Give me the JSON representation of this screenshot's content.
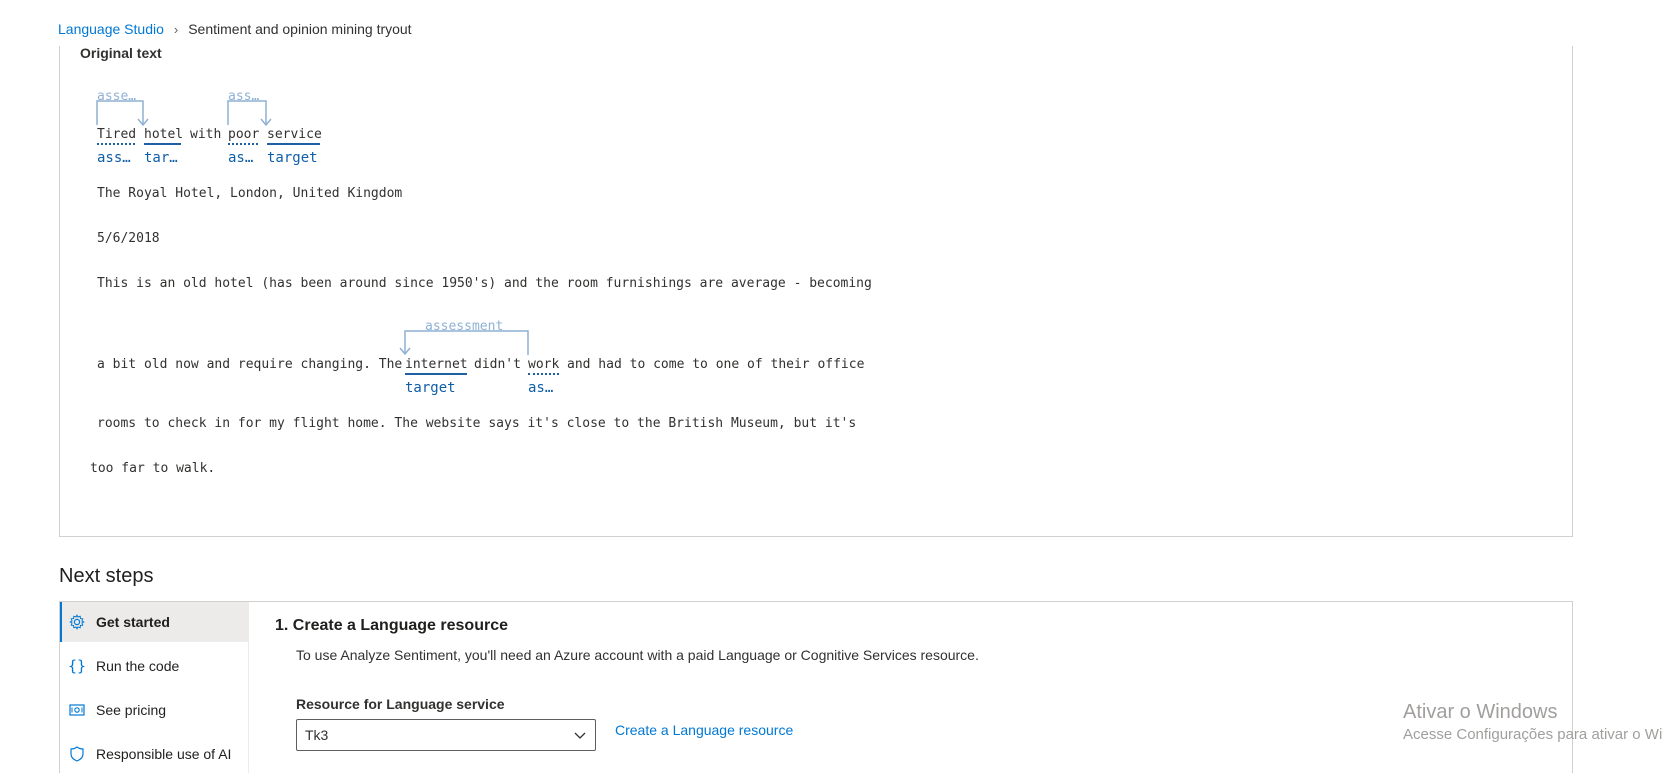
{
  "breadcrumb": {
    "root": "Language Studio",
    "separator": "›",
    "current": "Sentiment and opinion mining tryout"
  },
  "original_text": {
    "title": "Original text",
    "sentence1": {
      "tokens": {
        "tired": "Tired",
        "hotel": "hotel",
        "with": "with",
        "poor": "poor",
        "service": "service"
      },
      "relations": [
        "asse…",
        "ass…"
      ],
      "labels": {
        "tired": "ass…",
        "hotel": "tar…",
        "poor": "as…",
        "service": "target"
      }
    },
    "line_hotel_name": "The Royal Hotel, London, United Kingdom",
    "line_date": "5/6/2018",
    "line_para1": "This is an old hotel (has been around since 1950's) and the room furnishings are average - becoming",
    "sentence2": {
      "prefix": "a bit old now and require changing. The",
      "internet": "internet",
      "didnt": "didn't",
      "work": "work",
      "suffix": "and had to come to one of their office",
      "relation": "assessment",
      "labels": {
        "internet": "target",
        "work": "as…"
      }
    },
    "line_para3": "rooms to check in for my flight home. The website says it's close to the British Museum, but it's",
    "line_para4": "too far to walk."
  },
  "next_steps": {
    "title": "Next steps",
    "sidebar": [
      {
        "label": "Get started",
        "icon": "gear-icon",
        "active": true
      },
      {
        "label": "Run the code",
        "icon": "code-braces-icon",
        "active": false
      },
      {
        "label": "See pricing",
        "icon": "pricing-icon",
        "active": false
      },
      {
        "label": "Responsible use of AI",
        "icon": "shield-icon",
        "active": false
      }
    ],
    "step_heading": "1. Create a Language resource",
    "step_description": "To use Analyze Sentiment, you'll need an Azure account with a paid Language or Cognitive Services resource.",
    "resource_label": "Resource for Language service",
    "resource_value": "Tk3",
    "create_link": "Create a Language resource"
  },
  "watermark": {
    "title": "Ativar o Windows",
    "subtitle": "Acesse Configurações para ativar o Windows."
  },
  "colors": {
    "accent": "#0078d4",
    "label_blue": "#0f5ea8",
    "relation_blue": "#8fb1d4"
  }
}
